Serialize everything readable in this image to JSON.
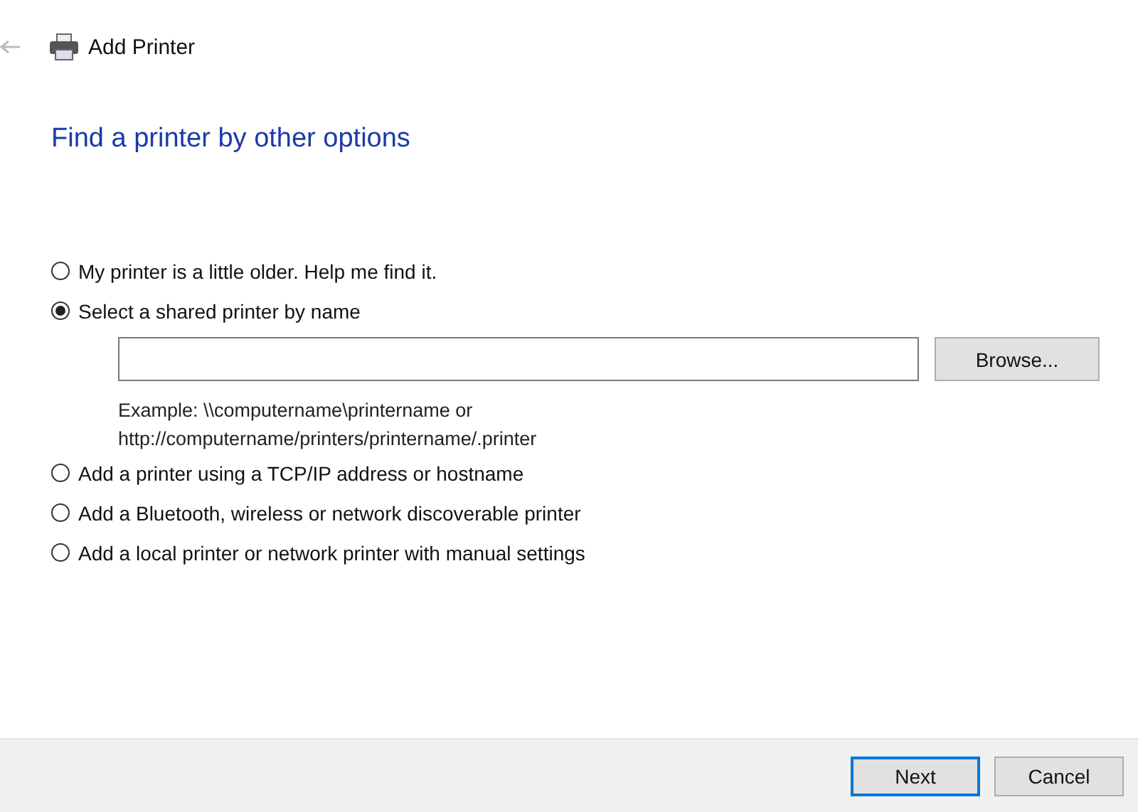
{
  "window": {
    "title": "Add Printer"
  },
  "heading": "Find a printer by other options",
  "options": [
    {
      "label": "My printer is a little older. Help me find it.",
      "selected": false
    },
    {
      "label": "Select a shared printer by name",
      "selected": true,
      "details": {
        "browse_button": "Browse...",
        "example": [
          "Example: \\\\computername\\printername or",
          "http://computername/printers/printername/.printer"
        ]
      }
    },
    {
      "label": "Add a printer using a TCP/IP address or hostname",
      "selected": false
    },
    {
      "label": "Add a Bluetooth, wireless or network discoverable printer",
      "selected": false
    },
    {
      "label": "Add a local printer or network printer with manual settings",
      "selected": false
    }
  ],
  "buttons": [
    {
      "label": "Next",
      "default": true
    },
    {
      "label": "Cancel",
      "default": false
    }
  ]
}
